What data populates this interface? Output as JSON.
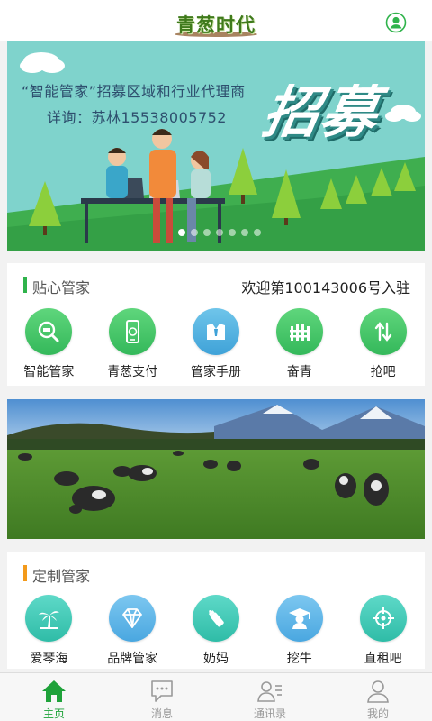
{
  "header": {
    "logo_text": "青葱时代",
    "user_icon": "user-circle-icon"
  },
  "banner": {
    "line1": "“智能管家”招募区域和行业代理商",
    "line2": "详询：苏林15538005752",
    "big_text": "招募",
    "dot_count": 7,
    "active_dot": 0
  },
  "section1": {
    "title": "贴心管家",
    "welcome": "欢迎第100143006号入驻",
    "items": [
      {
        "label": "智能管家",
        "icon": "magnifier-icon"
      },
      {
        "label": "青葱支付",
        "icon": "phone-pay-icon"
      },
      {
        "label": "管家手册",
        "icon": "suit-icon"
      },
      {
        "label": "奋青",
        "icon": "fence-icon"
      },
      {
        "label": "抢吧",
        "icon": "arrows-icon"
      }
    ]
  },
  "section2": {
    "title": "定制管家",
    "items": [
      {
        "label": "爱琴海",
        "icon": "palm-tree-icon"
      },
      {
        "label": "品牌管家",
        "icon": "diamond-icon"
      },
      {
        "label": "奶妈",
        "icon": "bottle-icon"
      },
      {
        "label": "挖牛",
        "icon": "graduate-icon"
      },
      {
        "label": "直租吧",
        "icon": "target-icon"
      }
    ]
  },
  "tabs": [
    {
      "label": "主页",
      "icon": "home-icon",
      "active": true
    },
    {
      "label": "消息",
      "icon": "chat-icon",
      "active": false
    },
    {
      "label": "通讯录",
      "icon": "contacts-icon",
      "active": false
    },
    {
      "label": "我的",
      "icon": "profile-icon",
      "active": false
    }
  ],
  "colors": {
    "accent_green": "#1fa23a",
    "section1_bar": "#2fb34b",
    "section2_bar": "#f39a1b",
    "banner_bg": "#7fd3cc"
  }
}
